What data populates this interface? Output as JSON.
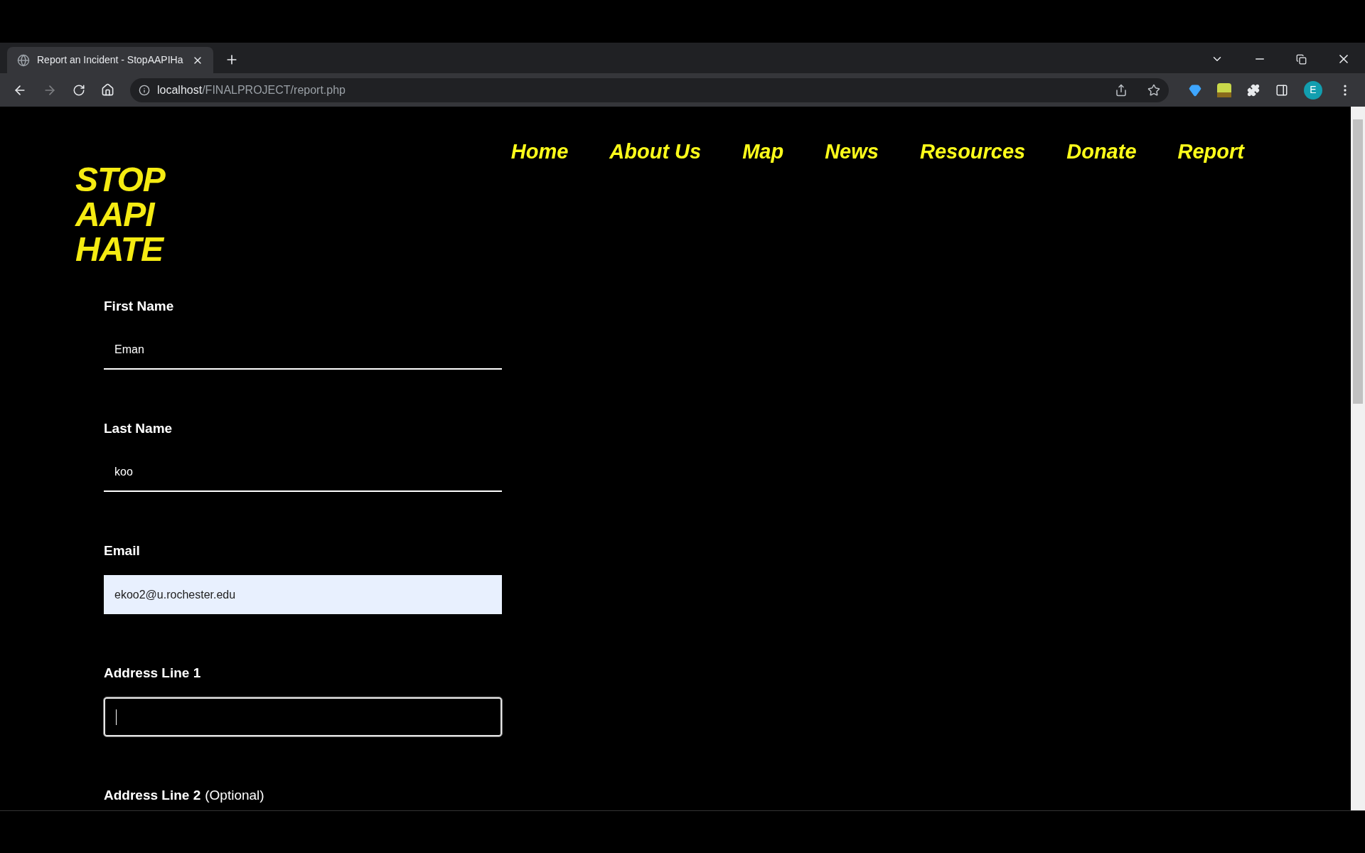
{
  "browser": {
    "tabs": [
      {
        "title": "Report an Incident - StopAAPIHa",
        "selected": true
      }
    ],
    "url": {
      "host": "localhost",
      "path": "/FINALPROJECT/report.php"
    },
    "profile_initial": "E"
  },
  "nav": [
    {
      "label": "Home"
    },
    {
      "label": "About Us"
    },
    {
      "label": "Map"
    },
    {
      "label": "News"
    },
    {
      "label": "Resources"
    },
    {
      "label": "Donate"
    },
    {
      "label": "Report"
    }
  ],
  "logo": {
    "lines": [
      "STOP",
      "AAPI",
      "HATE"
    ]
  },
  "form": {
    "fields": [
      {
        "kind": "input",
        "label": "First Name",
        "value": "Eman",
        "autofilled": false,
        "focused": false
      },
      {
        "kind": "input",
        "label": "Last Name",
        "value": "koo",
        "autofilled": false,
        "focused": false
      },
      {
        "kind": "input",
        "label": "Email",
        "value": "ekoo2@u.rochester.edu",
        "autofilled": true,
        "focused": false
      },
      {
        "kind": "input",
        "label": "Address Line 1",
        "autofilled": false,
        "focused": true
      },
      {
        "kind": "label",
        "label": "Address Line 2",
        "note": "(Optional)"
      }
    ]
  }
}
